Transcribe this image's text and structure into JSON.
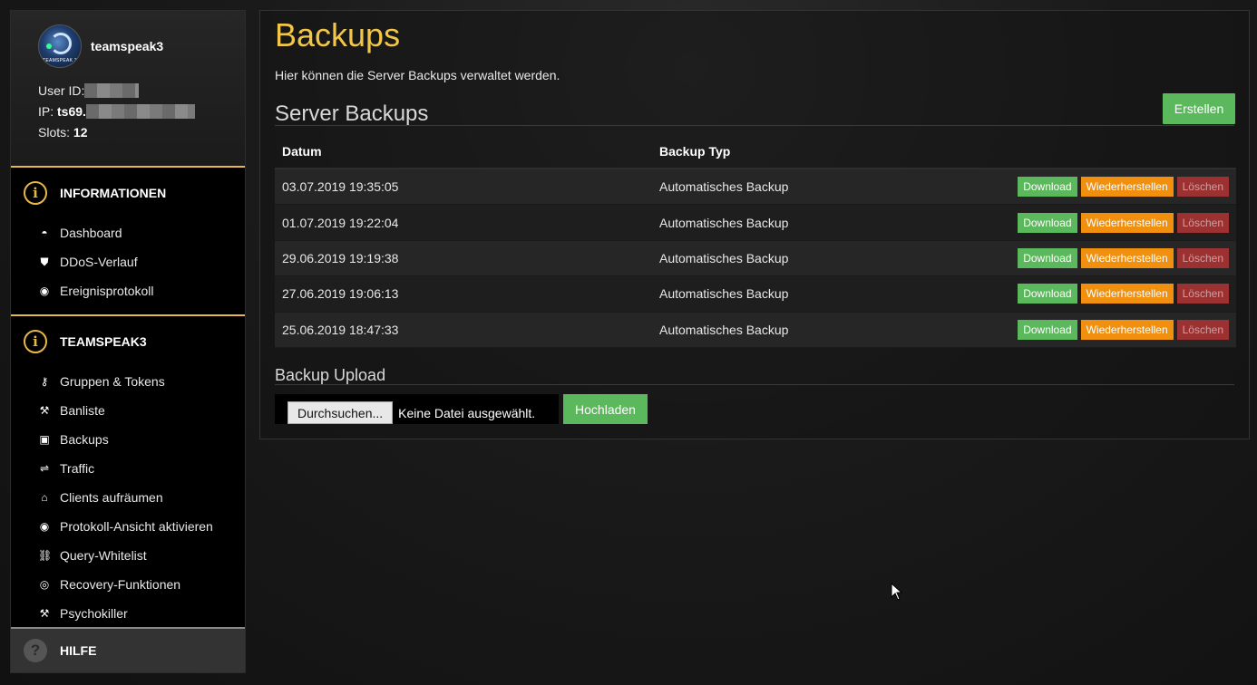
{
  "sidebar": {
    "avatar_caption": "TEAMSPEAK 3",
    "username": "teamspeak3",
    "user_id_label": "User ID:",
    "ip_label": "IP:",
    "ip_value": "ts69.",
    "slots_label": "Slots:",
    "slots_value": "12",
    "sections": [
      {
        "title": "INFORMATIONEN",
        "items": [
          {
            "label": "Dashboard",
            "icon": "gauge-icon"
          },
          {
            "label": "DDoS-Verlauf",
            "icon": "shield-icon"
          },
          {
            "label": "Ereignisprotokoll",
            "icon": "eye-icon"
          }
        ]
      },
      {
        "title": "TEAMSPEAK3",
        "items": [
          {
            "label": "Gruppen & Tokens",
            "icon": "key-icon"
          },
          {
            "label": "Banliste",
            "icon": "gavel-icon"
          },
          {
            "label": "Backups",
            "icon": "floppy-icon"
          },
          {
            "label": "Traffic",
            "icon": "traffic-icon"
          },
          {
            "label": "Clients aufräumen",
            "icon": "trash-icon"
          },
          {
            "label": "Protokoll-Ansicht aktivieren",
            "icon": "eye-icon"
          },
          {
            "label": "Query-Whitelist",
            "icon": "link-icon"
          },
          {
            "label": "Recovery-Funktionen",
            "icon": "lifebuoy-icon"
          },
          {
            "label": "Psychokiller",
            "icon": "wrench-icon"
          }
        ]
      }
    ],
    "help": "HILFE"
  },
  "main": {
    "title": "Backups",
    "subtitle": "Hier können die Server Backups verwaltet werden.",
    "server_backups_heading": "Server Backups",
    "create_button": "Erstellen",
    "table": {
      "columns": [
        "Datum",
        "Backup Typ"
      ],
      "rows": [
        {
          "date": "03.07.2019 19:35:05",
          "type": "Automatisches Backup"
        },
        {
          "date": "01.07.2019 19:22:04",
          "type": "Automatisches Backup"
        },
        {
          "date": "29.06.2019 19:19:38",
          "type": "Automatisches Backup"
        },
        {
          "date": "27.06.2019 19:06:13",
          "type": "Automatisches Backup"
        },
        {
          "date": "25.06.2019 18:47:33",
          "type": "Automatisches Backup"
        }
      ],
      "actions": {
        "download": "Download",
        "restore": "Wiederherstellen",
        "delete": "Löschen"
      }
    },
    "upload_heading": "Backup Upload",
    "browse_button": "Durchsuchen...",
    "no_file": "Keine Datei ausgewählt.",
    "upload_button": "Hochladen"
  },
  "colors": {
    "accent": "#e6b84a",
    "title": "#f2c646",
    "success": "#5cb85c",
    "warning": "#f0900e",
    "danger": "#9c3131"
  }
}
